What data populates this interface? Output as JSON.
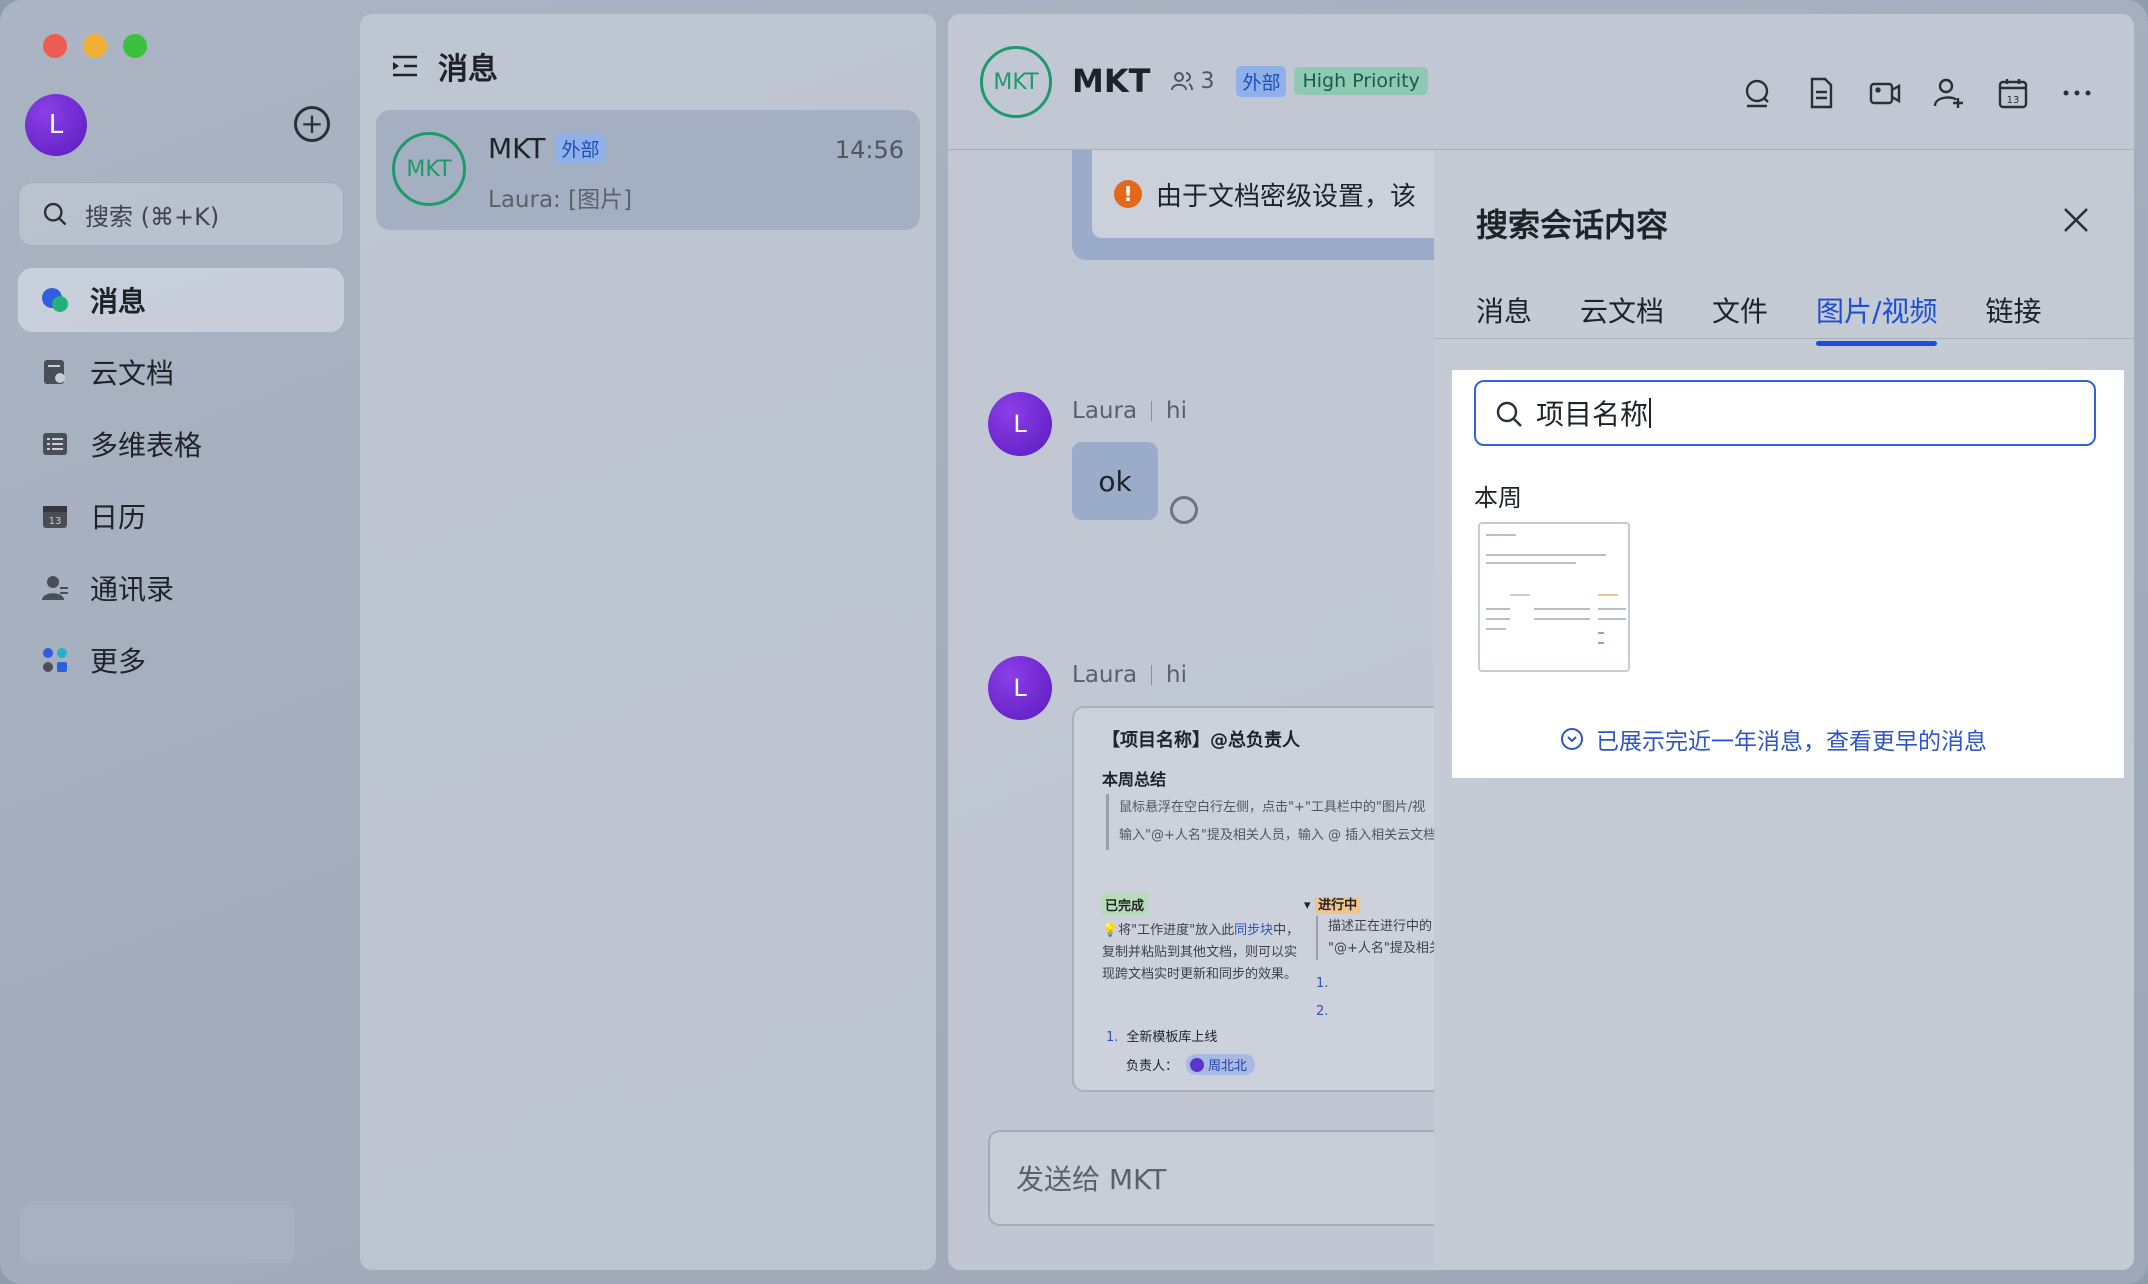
{
  "sidebar": {
    "avatar_letter": "L",
    "search_placeholder": "搜索 (⌘+K)",
    "items": [
      {
        "label": "消息",
        "icon": "chat-bubble-icon",
        "active": true
      },
      {
        "label": "云文档",
        "icon": "cloud-doc-icon"
      },
      {
        "label": "多维表格",
        "icon": "table-icon"
      },
      {
        "label": "日历",
        "icon": "calendar-icon"
      },
      {
        "label": "通讯录",
        "icon": "contacts-icon"
      },
      {
        "label": "更多",
        "icon": "apps-icon"
      }
    ]
  },
  "list": {
    "header": "消息",
    "chat": {
      "avatar": "MKT",
      "name": "MKT",
      "tag": "外部",
      "time": "14:56",
      "preview": "Laura: [图片]"
    }
  },
  "chat": {
    "avatar": "MKT",
    "title": "MKT",
    "members": "3",
    "tag_external": "外部",
    "tag_priority": "High Priority",
    "tools": [
      "search-icon",
      "doc-icon",
      "video-icon",
      "add-member-icon",
      "calendar-icon",
      "more-icon"
    ],
    "warning_text": "由于文档密级设置，该",
    "messages": [
      {
        "sender": "Laura",
        "avatar": "L",
        "reply_to": "hi",
        "text": "ok"
      },
      {
        "sender": "Laura",
        "avatar": "L",
        "reply_to": "hi"
      }
    ],
    "doc": {
      "title": "【项目名称】@总负责人",
      "section": "本周总结",
      "quote_lines": [
        "鼠标悬浮在空白行左侧，点击\"+\"工具栏中的\"图片/视",
        "输入\"@+人名\"提及相关人员，输入 @ 插入相关云文档"
      ],
      "done_label": "已完成",
      "doing_label": "进行中",
      "done_text_prefix": "💡将\"工作进度\"放入此",
      "done_text_link": "同步块",
      "done_text_rest": "中，复制并粘贴到其他文档，则可以实现跨文档实时更新和同步的效果。",
      "doing_lines": [
        "描述正在进行中的",
        "\"@+人名\"提及相关"
      ],
      "doing_nums": [
        "1.",
        "2."
      ],
      "item1_num": "1.",
      "item1": "全新模板库上线",
      "owner_label": "负责人：",
      "owner_name": "周北北"
    },
    "send_placeholder": "发送给 MKT"
  },
  "search_panel": {
    "title": "搜索会话内容",
    "tabs": [
      "消息",
      "云文档",
      "文件",
      "图片/视频",
      "链接"
    ],
    "active_tab": 3,
    "query": "项目名称",
    "group": "本周",
    "load_more": "已展示完近一年消息，查看更早的消息"
  }
}
